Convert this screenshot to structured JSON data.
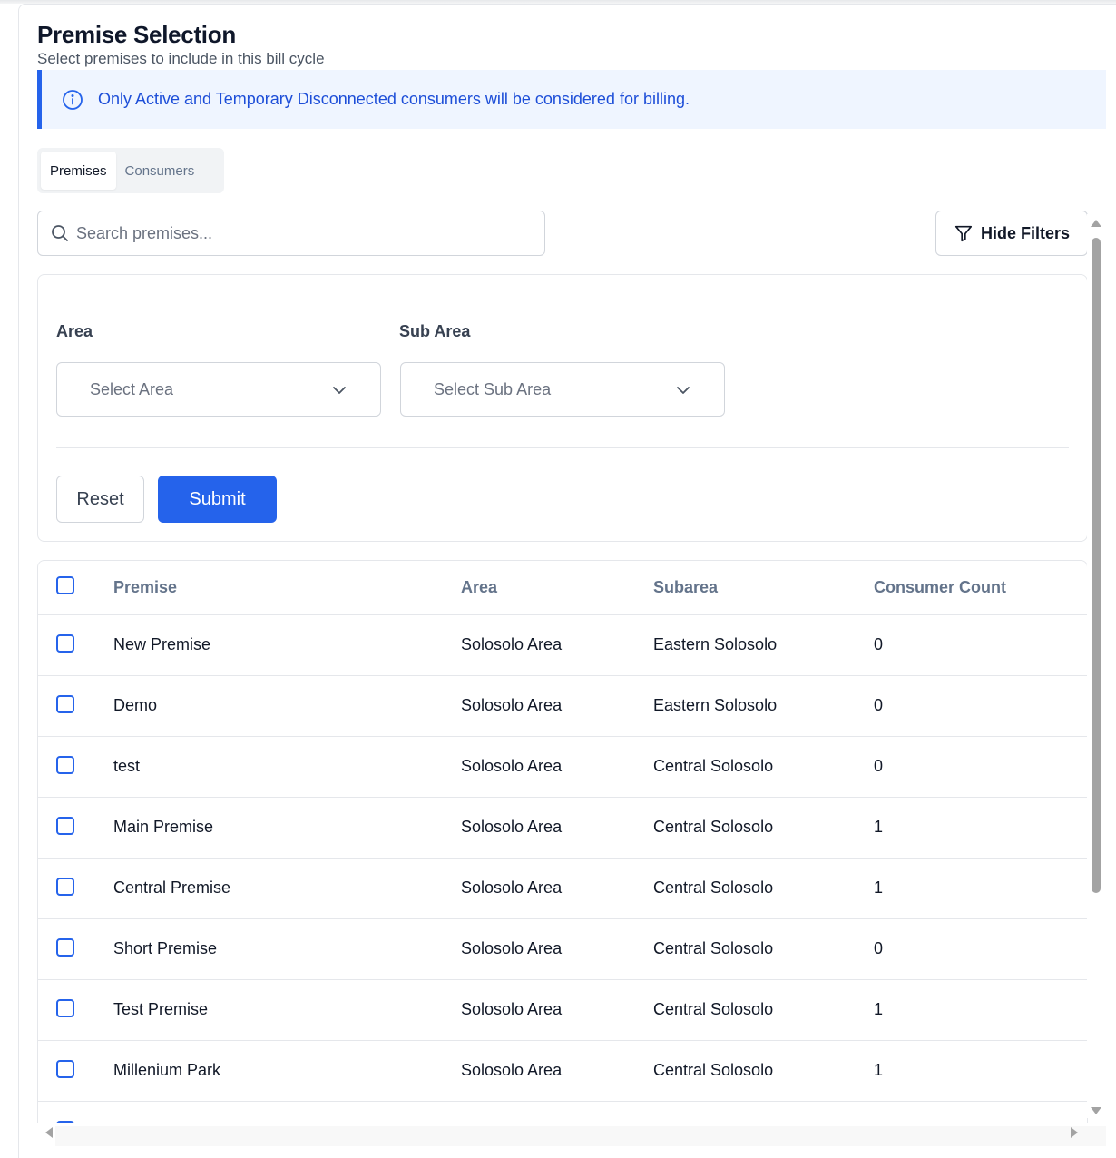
{
  "header": {
    "title": "Premise Selection",
    "subtitle": "Select premises to include in this bill cycle"
  },
  "alert": {
    "text": "Only Active and Temporary Disconnected consumers will be considered for billing.",
    "icon": "info-icon",
    "color": "#2563eb"
  },
  "tabs": [
    {
      "label": "Premises",
      "active": true
    },
    {
      "label": "Consumers",
      "active": false
    }
  ],
  "search": {
    "placeholder": "Search premises...",
    "value": ""
  },
  "toolbar": {
    "hide_filters_label": "Hide Filters"
  },
  "filters": {
    "area_label": "Area",
    "area_placeholder": "Select Area",
    "subarea_label": "Sub Area",
    "subarea_placeholder": "Select Sub Area",
    "reset_label": "Reset",
    "submit_label": "Submit"
  },
  "table": {
    "columns": [
      "Premise",
      "Area",
      "Subarea",
      "Consumer Count"
    ],
    "rows": [
      {
        "premise": "New Premise",
        "area": "Solosolo Area",
        "subarea": "Eastern Solosolo",
        "count": "0"
      },
      {
        "premise": "Demo",
        "area": "Solosolo Area",
        "subarea": "Eastern Solosolo",
        "count": "0"
      },
      {
        "premise": "test",
        "area": "Solosolo Area",
        "subarea": "Central Solosolo",
        "count": "0"
      },
      {
        "premise": "Main Premise",
        "area": "Solosolo Area",
        "subarea": "Central Solosolo",
        "count": "1"
      },
      {
        "premise": "Central Premise",
        "area": "Solosolo Area",
        "subarea": "Central Solosolo",
        "count": "1"
      },
      {
        "premise": "Short Premise",
        "area": "Solosolo Area",
        "subarea": "Central Solosolo",
        "count": "0"
      },
      {
        "premise": "Test Premise",
        "area": "Solosolo Area",
        "subarea": "Central Solosolo",
        "count": "1"
      },
      {
        "premise": "Millenium Park",
        "area": "Solosolo Area",
        "subarea": "Central Solosolo",
        "count": "1"
      }
    ]
  },
  "colors": {
    "primary": "#2563eb",
    "alert_bg": "#eff5ff",
    "border": "#e5e7eb"
  }
}
